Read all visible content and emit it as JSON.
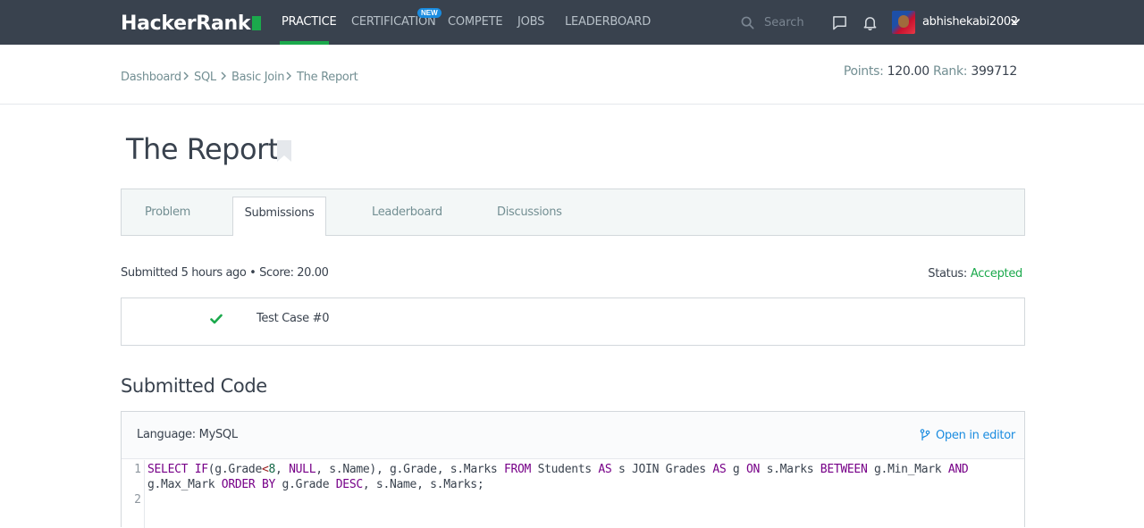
{
  "nav": {
    "logo": "HackerRank",
    "items": [
      "PRACTICE",
      "CERTIFICATION",
      "COMPETE",
      "JOBS",
      "LEADERBOARD"
    ],
    "new_badge": "NEW",
    "search_placeholder": "Search",
    "username": "abhishekabi2002",
    "icons": [
      "search-icon",
      "chat-icon",
      "bell-icon",
      "chevron-down-icon"
    ],
    "accent": "#1ba94c"
  },
  "breadcrumb": [
    "Dashboard",
    "SQL",
    "Basic Join",
    "The Report"
  ],
  "stats": {
    "points_label": "Points:",
    "points": "120.00",
    "rank_label": "Rank:",
    "rank": "399712"
  },
  "page": {
    "title": "The Report"
  },
  "tabs": [
    "Problem",
    "Submissions",
    "Leaderboard",
    "Discussions"
  ],
  "submission": {
    "info": "Submitted 5 hours ago • Score: 20.00",
    "status_label": "Status:",
    "status": "Accepted",
    "status_color": "#1ba94c",
    "test_cases": [
      "Test Case #0"
    ]
  },
  "code": {
    "heading": "Submitted Code",
    "language": "Language: MySQL",
    "open_in_editor": "Open in editor",
    "line_numbers": [
      "1",
      "2"
    ],
    "line1": {
      "t1": "SELECT",
      "t2": "IF",
      "t3": "(g.Grade",
      "t4": "<",
      "t5": "8",
      "t6": ", ",
      "t7": "NULL",
      "t8": ", s.Name), g.Grade, s.Marks ",
      "t9": "FROM",
      "t10": " Students ",
      "t11": "AS",
      "t12": " s JOIN Grades ",
      "t13": "AS",
      "t14": " g ",
      "t15": "ON",
      "t16": " s.Marks ",
      "t17": "BETWEEN",
      "t18": " g.Min_Mark ",
      "t19": "AND"
    },
    "line1b": {
      "t1": "g.Max_Mark ",
      "t2": "ORDER BY",
      "t3": " g.Grade ",
      "t4": "DESC",
      "t5": ", s.Name, s.Marks;"
    }
  }
}
